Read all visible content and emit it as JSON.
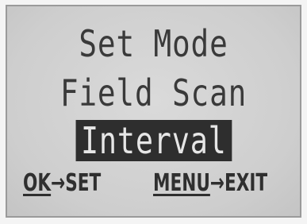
{
  "screen": {
    "title": "Set Mode",
    "menu_item": "Field Scan",
    "selected_item": "Interval"
  },
  "footer": {
    "ok_key": "OK",
    "ok_arrow": "→",
    "ok_action": "SET",
    "menu_key": "MENU",
    "menu_arrow": "→",
    "menu_action": "EXIT"
  },
  "colors": {
    "lcd_background": "#d2d2d2",
    "lcd_text": "#3a3a3a",
    "highlight_background": "#2e2e2e",
    "highlight_text": "#e6e6e6"
  }
}
